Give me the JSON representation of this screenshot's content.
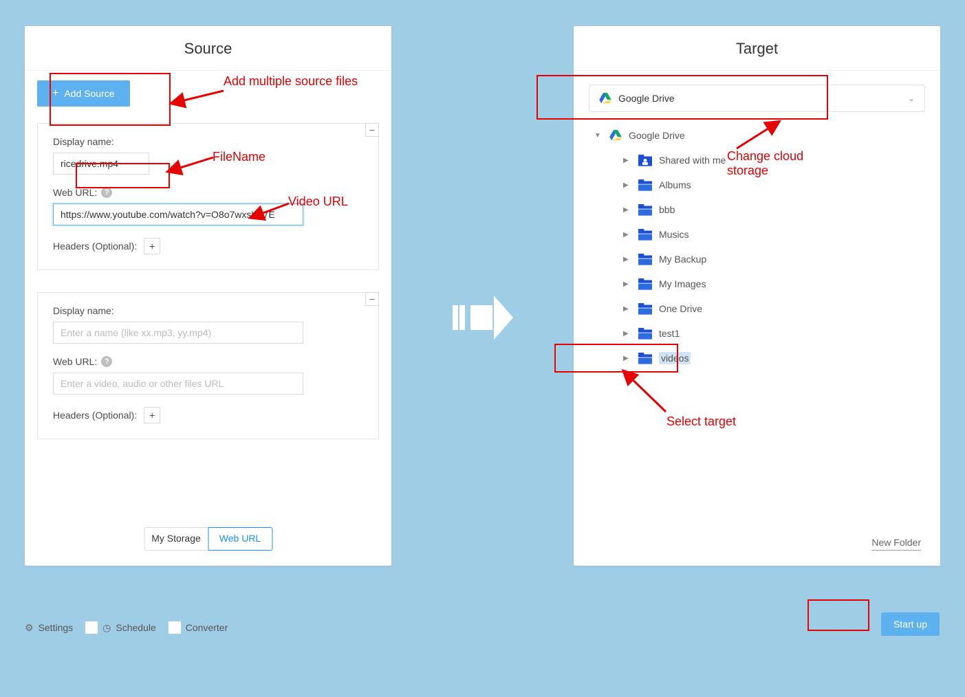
{
  "source": {
    "title": "Source",
    "add_button": "Add Source",
    "cards": [
      {
        "display_label": "Display name:",
        "display_value": "ricedrive.mp4",
        "display_placeholder": "",
        "url_label": "Web URL:",
        "url_value": "https://www.youtube.com/watch?v=O8o7wxsKa7E",
        "url_placeholder": "",
        "headers_label": "Headers (Optional):"
      },
      {
        "display_label": "Display name:",
        "display_value": "",
        "display_placeholder": "Enter a name (like xx.mp3, yy.mp4)",
        "url_label": "Web URL:",
        "url_value": "",
        "url_placeholder": "Enter a video, audio or other files URL",
        "headers_label": "Headers (Optional):"
      }
    ],
    "tabs": {
      "storage": "My Storage",
      "weburl": "Web URL"
    }
  },
  "target": {
    "title": "Target",
    "selected_drive": "Google Drive",
    "root": "Google Drive",
    "folders": [
      "Shared with me",
      "Albums",
      "bbb",
      "Musics",
      "My Backup",
      "My Images",
      "One Drive",
      "test1",
      "videos"
    ],
    "new_folder": "New Folder"
  },
  "bottom": {
    "settings": "Settings",
    "schedule": "Schedule",
    "converter": "Converter",
    "start": "Start up"
  },
  "annotations": {
    "add_multi": "Add multiple source files",
    "filename": "FileName",
    "videourl": "Video URL",
    "change_cloud": "Change cloud\nstorage",
    "select_target": "Select target"
  }
}
